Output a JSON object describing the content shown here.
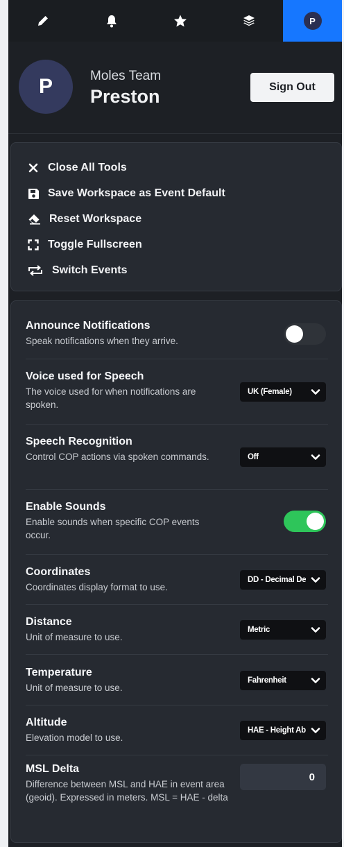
{
  "topbar": {
    "tabs": [
      {
        "icon": "pencil-icon"
      },
      {
        "icon": "bell-icon"
      },
      {
        "icon": "star-icon"
      },
      {
        "icon": "layers-icon"
      },
      {
        "icon": "profile-icon",
        "initial": "P",
        "active": true
      }
    ],
    "accent_color": "#1677ff"
  },
  "profile": {
    "avatar_initial": "P",
    "team": "Moles Team",
    "name": "Preston",
    "sign_out_label": "Sign Out"
  },
  "actions": [
    {
      "icon": "close-icon",
      "label": "Close All Tools"
    },
    {
      "icon": "save-icon",
      "label": "Save Workspace as Event Default"
    },
    {
      "icon": "eraser-icon",
      "label": "Reset Workspace"
    },
    {
      "icon": "fullscreen-icon",
      "label": "Toggle Fullscreen"
    },
    {
      "icon": "switch-icon",
      "label": "Switch Events"
    }
  ],
  "settings": {
    "announce": {
      "title": "Announce Notifications",
      "desc": "Speak notifications when they arrive.",
      "enabled": false
    },
    "voice": {
      "title": "Voice used for Speech",
      "desc": "The voice used for when notifications are spoken.",
      "value": "UK (Female)"
    },
    "speech": {
      "title": "Speech Recognition",
      "desc": "Control COP actions via spoken commands.",
      "value": "Off"
    },
    "sounds": {
      "title": "Enable Sounds",
      "desc": "Enable sounds when specific COP events occur.",
      "enabled": true
    },
    "coordinates": {
      "title": "Coordinates",
      "desc": "Coordinates display format to use.",
      "value": "DD - Decimal Degrees"
    },
    "distance": {
      "title": "Distance",
      "desc": "Unit of measure to use.",
      "value": "Metric"
    },
    "temperature": {
      "title": "Temperature",
      "desc": "Unit of measure to use.",
      "value": "Fahrenheit"
    },
    "altitude": {
      "title": "Altitude",
      "desc": "Elevation model to use.",
      "value": "HAE - Height Above Ellipsoid"
    },
    "msl": {
      "title": "MSL Delta",
      "desc": "Difference between MSL and HAE in event area (geoid). Expressed in meters. MSL = HAE - delta",
      "value": "0"
    }
  },
  "colors": {
    "toggle_on": "#2ec55a",
    "toggle_off": "#2f3339"
  }
}
